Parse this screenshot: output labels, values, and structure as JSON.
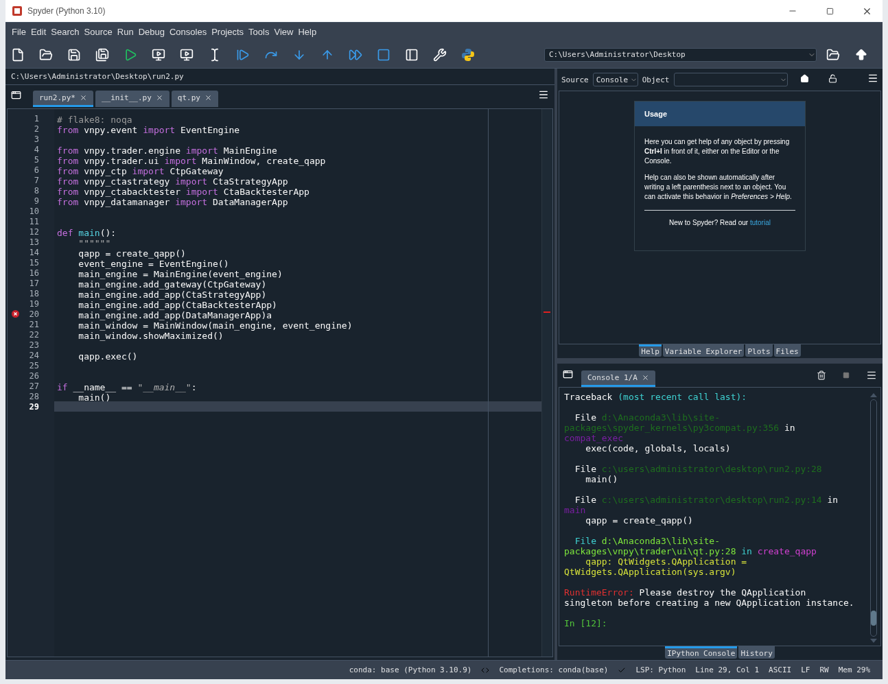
{
  "window": {
    "title": "Spyder (Python 3.10)"
  },
  "menu": [
    "File",
    "Edit",
    "Search",
    "Source",
    "Run",
    "Debug",
    "Consoles",
    "Projects",
    "Tools",
    "View",
    "Help"
  ],
  "working_directory": {
    "value": "C:\\Users\\Administrator\\Desktop"
  },
  "editor": {
    "file_path": "C:\\Users\\Administrator\\Desktop\\run2.py",
    "tabs": [
      {
        "label": "run2.py*",
        "selected": true
      },
      {
        "label": "__init__.py",
        "selected": false
      },
      {
        "label": "qt.py",
        "selected": false
      }
    ],
    "lines": [
      {
        "num": "1",
        "error": false,
        "current": false,
        "tokens": [
          {
            "kind": "comment",
            "text": "# flake8: noqa"
          }
        ]
      },
      {
        "num": "2",
        "error": false,
        "current": false,
        "tokens": [
          {
            "kind": "keyword",
            "text": "from"
          },
          {
            "kind": "text",
            "text": " vnpy.event "
          },
          {
            "kind": "keyword",
            "text": "import"
          },
          {
            "kind": "text",
            "text": " EventEngine"
          }
        ]
      },
      {
        "num": "3",
        "error": false,
        "current": false
      },
      {
        "num": "4",
        "error": false,
        "current": false,
        "tokens": [
          {
            "kind": "keyword",
            "text": "from"
          },
          {
            "kind": "text",
            "text": " vnpy.trader.engine "
          },
          {
            "kind": "keyword",
            "text": "import"
          },
          {
            "kind": "text",
            "text": " MainEngine"
          }
        ]
      },
      {
        "num": "5",
        "error": false,
        "current": false,
        "tokens": [
          {
            "kind": "keyword",
            "text": "from"
          },
          {
            "kind": "text",
            "text": " vnpy.trader.ui "
          },
          {
            "kind": "keyword",
            "text": "import"
          },
          {
            "kind": "text",
            "text": " MainWindow, create_qapp"
          }
        ]
      },
      {
        "num": "6",
        "error": false,
        "current": false,
        "tokens": [
          {
            "kind": "keyword",
            "text": "from"
          },
          {
            "kind": "text",
            "text": " vnpy_ctp "
          },
          {
            "kind": "keyword",
            "text": "import"
          },
          {
            "kind": "text",
            "text": " CtpGateway"
          }
        ]
      },
      {
        "num": "7",
        "error": false,
        "current": false,
        "tokens": [
          {
            "kind": "keyword",
            "text": "from"
          },
          {
            "kind": "text",
            "text": " vnpy_ctastrategy "
          },
          {
            "kind": "keyword",
            "text": "import"
          },
          {
            "kind": "text",
            "text": " CtaStrategyApp"
          }
        ]
      },
      {
        "num": "8",
        "error": false,
        "current": false,
        "tokens": [
          {
            "kind": "keyword",
            "text": "from"
          },
          {
            "kind": "text",
            "text": " vnpy_ctabacktester "
          },
          {
            "kind": "keyword",
            "text": "import"
          },
          {
            "kind": "text",
            "text": " CtaBacktesterApp"
          }
        ]
      },
      {
        "num": "9",
        "error": false,
        "current": false,
        "tokens": [
          {
            "kind": "keyword",
            "text": "from"
          },
          {
            "kind": "text",
            "text": " vnpy_datamanager "
          },
          {
            "kind": "keyword",
            "text": "import"
          },
          {
            "kind": "text",
            "text": " DataManagerApp"
          }
        ]
      },
      {
        "num": "10",
        "error": false,
        "current": false
      },
      {
        "num": "11",
        "error": false,
        "current": false
      },
      {
        "num": "12",
        "error": false,
        "current": false,
        "tokens": [
          {
            "kind": "keyword",
            "text": "def "
          },
          {
            "kind": "function",
            "text": "main"
          },
          {
            "kind": "text",
            "text": "():"
          }
        ]
      },
      {
        "num": "13",
        "error": false,
        "current": false,
        "tokens": [
          {
            "kind": "string",
            "text": "    \"\"\"\"\"\""
          }
        ]
      },
      {
        "num": "14",
        "error": false,
        "current": false,
        "tokens": [
          {
            "kind": "text",
            "text": "    qapp = create_qapp()"
          }
        ]
      },
      {
        "num": "15",
        "error": false,
        "current": false,
        "tokens": [
          {
            "kind": "text",
            "text": "    event_engine = EventEngine()"
          }
        ]
      },
      {
        "num": "16",
        "error": false,
        "current": false,
        "tokens": [
          {
            "kind": "text",
            "text": "    main_engine = MainEngine(event_engine)"
          }
        ]
      },
      {
        "num": "17",
        "error": false,
        "current": false,
        "tokens": [
          {
            "kind": "text",
            "text": "    main_engine.add_gateway(CtpGateway)"
          }
        ]
      },
      {
        "num": "18",
        "error": false,
        "current": false,
        "tokens": [
          {
            "kind": "text",
            "text": "    main_engine.add_app(CtaStrategyApp)"
          }
        ]
      },
      {
        "num": "19",
        "error": false,
        "current": false,
        "tokens": [
          {
            "kind": "text",
            "text": "    main_engine.add_app(CtaBacktesterApp)"
          }
        ]
      },
      {
        "num": "20",
        "error": true,
        "current": false,
        "tokens": [
          {
            "kind": "text",
            "text": "    main_engine.add_app(DataManagerApp)a"
          }
        ]
      },
      {
        "num": "21",
        "error": false,
        "current": false,
        "tokens": [
          {
            "kind": "text",
            "text": "    main_window = MainWindow(main_engine, event_engine)"
          }
        ]
      },
      {
        "num": "22",
        "error": false,
        "current": false,
        "tokens": [
          {
            "kind": "text",
            "text": "    main_window.showMaximized()"
          }
        ]
      },
      {
        "num": "23",
        "error": false,
        "current": false
      },
      {
        "num": "24",
        "error": false,
        "current": false,
        "tokens": [
          {
            "kind": "text",
            "text": "    qapp.exec()"
          }
        ]
      },
      {
        "num": "25",
        "error": false,
        "current": false
      },
      {
        "num": "26",
        "error": false,
        "current": false
      },
      {
        "num": "27",
        "error": false,
        "current": false,
        "tokens": [
          {
            "kind": "keyword",
            "text": "if"
          },
          {
            "kind": "text",
            "text": " __name__ == "
          },
          {
            "kind": "string",
            "text": "\""
          },
          {
            "kind": "magic",
            "text": "__main__"
          },
          {
            "kind": "string",
            "text": "\""
          },
          {
            "kind": "text",
            "text": ":"
          }
        ]
      },
      {
        "num": "28",
        "error": false,
        "current": false,
        "tokens": [
          {
            "kind": "text",
            "text": "    main()"
          }
        ]
      },
      {
        "num": "29",
        "error": false,
        "current": true
      }
    ]
  },
  "help": {
    "source_label": "Source",
    "source_value": "Console",
    "object_label": "Object",
    "usage": {
      "title": "Usage",
      "paragraphs": [
        "Here you can get help of any object by pressing **Ctrl+I** in front of it, either on the Editor or the Console.",
        "Help can also be shown automatically after writing a left parenthesis next to an object. You can activate this behavior in *Preferences > Help*."
      ],
      "footer": "New to Spyder? Read our ",
      "link": "tutorial"
    },
    "tabs": [
      {
        "label": "Help",
        "selected": true
      },
      {
        "label": "Variable Explorer",
        "selected": false
      },
      {
        "label": "Plots",
        "selected": false
      },
      {
        "label": "Files",
        "selected": false
      }
    ]
  },
  "console": {
    "tabs": [
      {
        "label": "Console 1/A",
        "selected": true
      }
    ],
    "blocks": [
      [
        [
          {
            "kind": "text",
            "text": "Traceback "
          },
          {
            "kind": "cyan",
            "text": "(most recent call last):"
          }
        ]
      ],
      [
        [
          {
            "kind": "text",
            "text": "  File "
          },
          {
            "kind": "path",
            "text": "d:\\Anaconda3\\lib\\site-"
          }
        ],
        [
          {
            "kind": "path",
            "text": "packages\\spyder_kernels\\py3compat.py:356"
          },
          {
            "kind": "text",
            "text": " in"
          }
        ],
        [
          {
            "kind": "purple",
            "text": "compat_exec"
          }
        ],
        [
          {
            "kind": "text",
            "text": "    exec(code, globals, locals)"
          }
        ]
      ],
      [
        [
          {
            "kind": "text",
            "text": "  File "
          },
          {
            "kind": "path",
            "text": "c:\\users\\administrator\\desktop\\run2.py:28"
          }
        ],
        [
          {
            "kind": "text",
            "text": "    main()"
          }
        ]
      ],
      [
        [
          {
            "kind": "text",
            "text": "  File "
          },
          {
            "kind": "path",
            "text": "c:\\users\\administrator\\desktop\\run2.py:14"
          },
          {
            "kind": "text",
            "text": " in"
          }
        ],
        [
          {
            "kind": "purple",
            "text": "main"
          }
        ],
        [
          {
            "kind": "text",
            "text": "    qapp = create_qapp()"
          }
        ]
      ],
      [
        [
          {
            "kind": "cyan",
            "text": "  File "
          },
          {
            "kind": "green",
            "text": "d:\\Anaconda3\\lib\\site-"
          }
        ],
        [
          {
            "kind": "green",
            "text": "packages\\vnpy\\trader\\ui\\qt.py:28"
          },
          {
            "kind": "cyan",
            "text": " in "
          },
          {
            "kind": "magenta",
            "text": "create_qapp"
          }
        ],
        [
          {
            "kind": "yellow",
            "text": "    qapp: QtWidgets.QApplication ="
          }
        ],
        [
          {
            "kind": "yellow",
            "text": "QtWidgets.QApplication(sys.argv)"
          }
        ]
      ],
      [
        [
          {
            "kind": "red",
            "text": "RuntimeError:"
          },
          {
            "kind": "text",
            "text": " Please destroy the QApplication"
          }
        ],
        [
          {
            "kind": "text",
            "text": "singleton before creating a new QApplication instance."
          }
        ]
      ]
    ],
    "prompt": "In [12]:",
    "bottom_tabs": [
      {
        "label": "IPython Console",
        "selected": true
      },
      {
        "label": "History",
        "selected": false
      }
    ]
  },
  "status_bar": [
    {
      "kind": "text",
      "text": "conda: base (Python 3.10.9)"
    },
    {
      "kind": "completions",
      "text": "Completions: conda(base)"
    },
    {
      "kind": "check",
      "text": "LSP: Python"
    },
    {
      "kind": "text",
      "text": "Line 29, Col 1"
    },
    {
      "kind": "text",
      "text": "ASCII"
    },
    {
      "kind": "text",
      "text": "LF"
    },
    {
      "kind": "text",
      "text": "RW"
    },
    {
      "kind": "text",
      "text": "Mem 29%"
    }
  ]
}
